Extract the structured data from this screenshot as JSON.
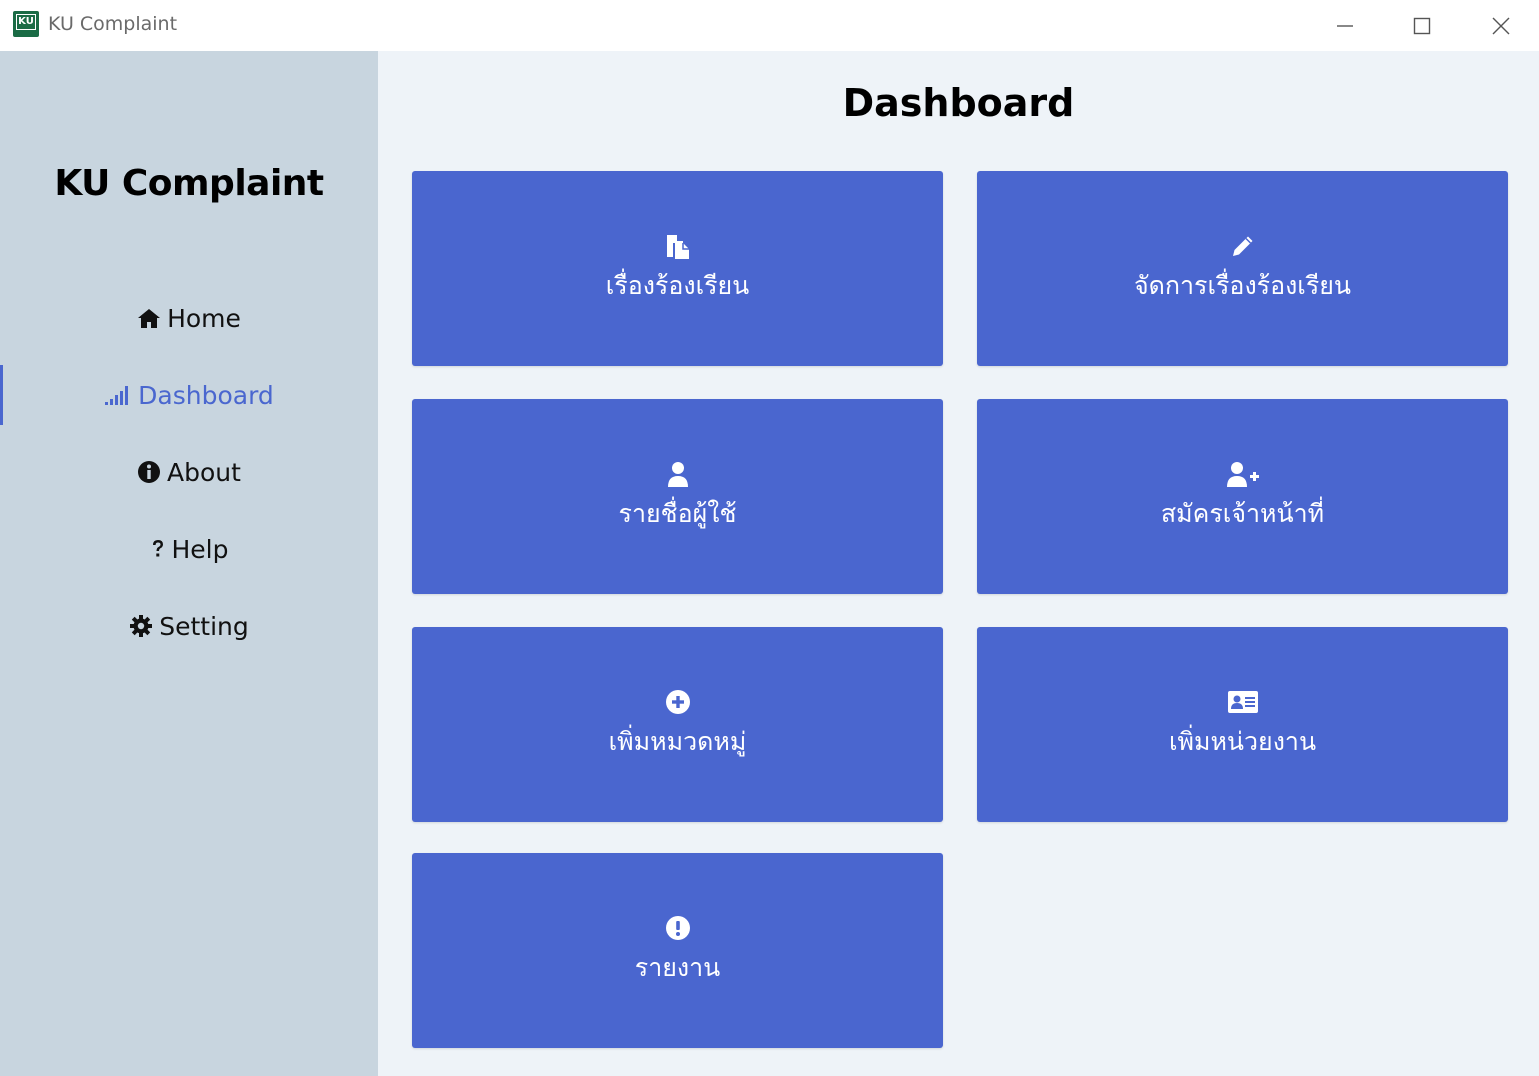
{
  "window": {
    "title": "KU Complaint",
    "icon_text": "KU"
  },
  "sidebar": {
    "brand": "KU Complaint",
    "items": [
      {
        "label": "Home",
        "icon": "home-icon"
      },
      {
        "label": "Dashboard",
        "icon": "signal-bars-icon",
        "active": true
      },
      {
        "label": "About",
        "icon": "info-circle-icon"
      },
      {
        "label": "Help",
        "icon": "question-icon"
      },
      {
        "label": "Setting",
        "icon": "gear-icon"
      }
    ]
  },
  "main": {
    "title": "Dashboard",
    "tiles": [
      {
        "label": "เรื่องร้องเรียน",
        "icon": "copy-document-icon"
      },
      {
        "label": "จัดการเรื่องร้องเรียน",
        "icon": "pencil-icon"
      },
      {
        "label": "รายชื่อผู้ใช้",
        "icon": "user-icon"
      },
      {
        "label": "สมัครเจ้าหน้าที่",
        "icon": "user-plus-icon"
      },
      {
        "label": "เพิ่มหมวดหมู่",
        "icon": "plus-circle-icon"
      },
      {
        "label": "เพิ่มหน่วยงาน",
        "icon": "id-card-icon"
      },
      {
        "label": "รายงาน",
        "icon": "exclamation-circle-icon"
      }
    ]
  },
  "colors": {
    "sidebar_bg": "#c8d5df",
    "main_bg": "#eef3f8",
    "tile_bg": "#4a66cf",
    "accent": "#4a67cf"
  }
}
